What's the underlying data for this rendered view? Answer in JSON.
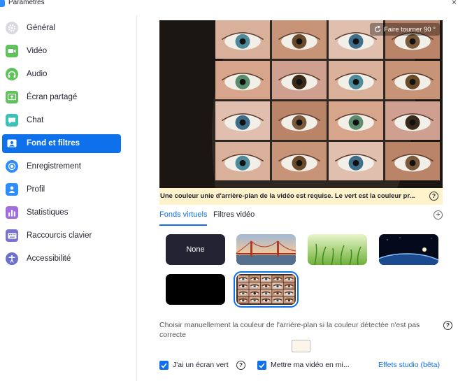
{
  "window": {
    "title": "Paramètres",
    "close_glyph": "×"
  },
  "sidebar": {
    "items": [
      {
        "label": "Général",
        "icon": "gear-icon",
        "color": "#D8D8DE",
        "active": false
      },
      {
        "label": "Vidéo",
        "icon": "video-camera-icon",
        "color": "#5FC25A",
        "active": false
      },
      {
        "label": "Audio",
        "icon": "headphones-icon",
        "color": "#5FC25A",
        "active": false
      },
      {
        "label": "Écran partagé",
        "icon": "share-screen-icon",
        "color": "#5FC25A",
        "active": false
      },
      {
        "label": "Chat",
        "icon": "chat-bubble-icon",
        "color": "#3CC1B6",
        "active": false
      },
      {
        "label": "Fond et filtres",
        "icon": "background-icon",
        "color": "#ffffff",
        "active": true
      },
      {
        "label": "Enregistrement",
        "icon": "record-icon",
        "color": "#2D8CFF",
        "active": false
      },
      {
        "label": "Profil",
        "icon": "profile-icon",
        "color": "#2D8CFF",
        "active": false
      },
      {
        "label": "Statistiques",
        "icon": "statistics-icon",
        "color": "#A26CE0",
        "active": false
      },
      {
        "label": "Raccourcis clavier",
        "icon": "keyboard-icon",
        "color": "#7A73CF",
        "active": false
      },
      {
        "label": "Accessibilité",
        "icon": "accessibility-icon",
        "color": "#6A6FD0",
        "active": false
      }
    ]
  },
  "preview": {
    "rotate_label": "Faire tourner 90 °"
  },
  "warning": {
    "text": "Une couleur unie d'arrière-plan de la vidéo est requise. Le vert est la couleur pr...",
    "help": "?"
  },
  "tabs": [
    {
      "label": "Fonds virtuels",
      "active": true
    },
    {
      "label": "Filtres vidéo",
      "active": false
    }
  ],
  "add_glyph": "+",
  "backgrounds": [
    {
      "label": "None",
      "kind": "none",
      "selected": false
    },
    {
      "label": "",
      "kind": "golden-gate-bridge",
      "selected": false
    },
    {
      "label": "",
      "kind": "grass",
      "selected": false
    },
    {
      "label": "",
      "kind": "earth-from-space",
      "selected": false
    },
    {
      "label": "",
      "kind": "black",
      "selected": false
    },
    {
      "label": "",
      "kind": "eyes-collage",
      "selected": true
    }
  ],
  "manual_color": {
    "text": "Choisir manuellement la couleur de l'arrière-plan si la couleur détectée n'est pas correcte",
    "help": "?",
    "swatch_color": "#FDF5E9"
  },
  "options": {
    "green_screen": {
      "label": "J'ai un écran vert",
      "checked": true,
      "help": "?"
    },
    "mirror": {
      "label": "Mettre ma vidéo en mi...",
      "checked": true
    },
    "studio_link": "Effets studio (bêta)"
  },
  "colors": {
    "accent": "#0E71EB",
    "warning_bg": "#FFF3CC"
  }
}
